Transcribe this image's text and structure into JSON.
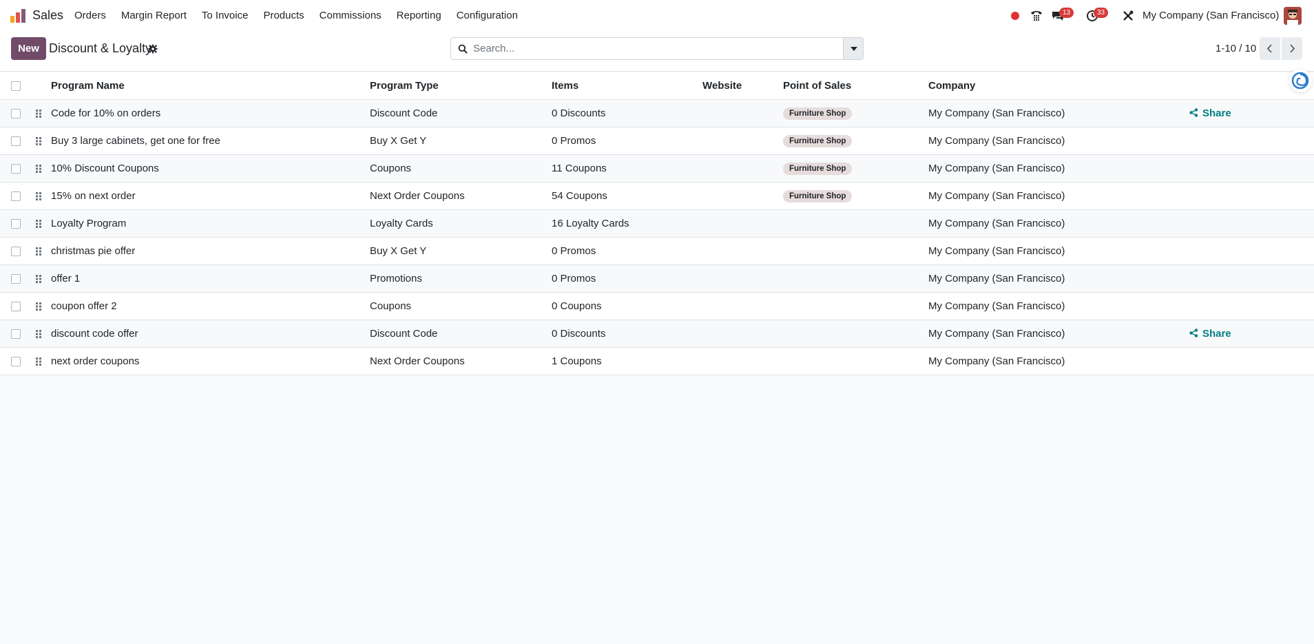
{
  "navbar": {
    "app_name": "Sales",
    "menu": [
      "Orders",
      "Margin Report",
      "To Invoice",
      "Products",
      "Commissions",
      "Reporting",
      "Configuration"
    ],
    "messages_count": "13",
    "activities_count": "33",
    "company": "My Company (San Francisco)",
    "icons": [
      "app-logo-icon",
      "recording-dot-icon",
      "phone-icon",
      "chat-icon",
      "clock-icon",
      "tools-icon",
      "avatar"
    ]
  },
  "control_panel": {
    "new_label": "New",
    "title": "Discount & Loyalty",
    "search_placeholder": "Search...",
    "pager": "1-10 / 10"
  },
  "table": {
    "headers": {
      "program_name": "Program Name",
      "program_type": "Program Type",
      "items": "Items",
      "website": "Website",
      "point_of_sales": "Point of Sales",
      "company": "Company"
    },
    "rows": [
      {
        "name": "Code for 10% on orders",
        "type": "Discount Code",
        "items": "0 Discounts",
        "pos": "Furniture Shop",
        "company": "My Company (San Francisco)",
        "share": "Share"
      },
      {
        "name": "Buy 3 large cabinets, get one for free",
        "type": "Buy X Get Y",
        "items": "0 Promos",
        "pos": "Furniture Shop",
        "company": "My Company (San Francisco)",
        "share": ""
      },
      {
        "name": "10% Discount Coupons",
        "type": "Coupons",
        "items": "11 Coupons",
        "pos": "Furniture Shop",
        "company": "My Company (San Francisco)",
        "share": ""
      },
      {
        "name": "15% on next order",
        "type": "Next Order Coupons",
        "items": "54 Coupons",
        "pos": "Furniture Shop",
        "company": "My Company (San Francisco)",
        "share": ""
      },
      {
        "name": "Loyalty Program",
        "type": "Loyalty Cards",
        "items": "16 Loyalty Cards",
        "pos": "",
        "company": "My Company (San Francisco)",
        "share": ""
      },
      {
        "name": "christmas pie offer",
        "type": "Buy X Get Y",
        "items": "0 Promos",
        "pos": "",
        "company": "My Company (San Francisco)",
        "share": ""
      },
      {
        "name": "offer 1",
        "type": "Promotions",
        "items": "0 Promos",
        "pos": "",
        "company": "My Company (San Francisco)",
        "share": ""
      },
      {
        "name": "coupon offer 2",
        "type": "Coupons",
        "items": "0 Coupons",
        "pos": "",
        "company": "My Company (San Francisco)",
        "share": ""
      },
      {
        "name": "discount code offer",
        "type": "Discount Code",
        "items": "0 Discounts",
        "pos": "",
        "company": "My Company (San Francisco)",
        "share": "Share"
      },
      {
        "name": "next order coupons",
        "type": "Next Order Coupons",
        "items": "1 Coupons",
        "pos": "",
        "company": "My Company (San Francisco)",
        "share": ""
      }
    ]
  },
  "colors": {
    "primary": "#714b67",
    "link": "#017e84",
    "badge": "#d63a3a",
    "tag_bg": "#e6dcdc"
  }
}
